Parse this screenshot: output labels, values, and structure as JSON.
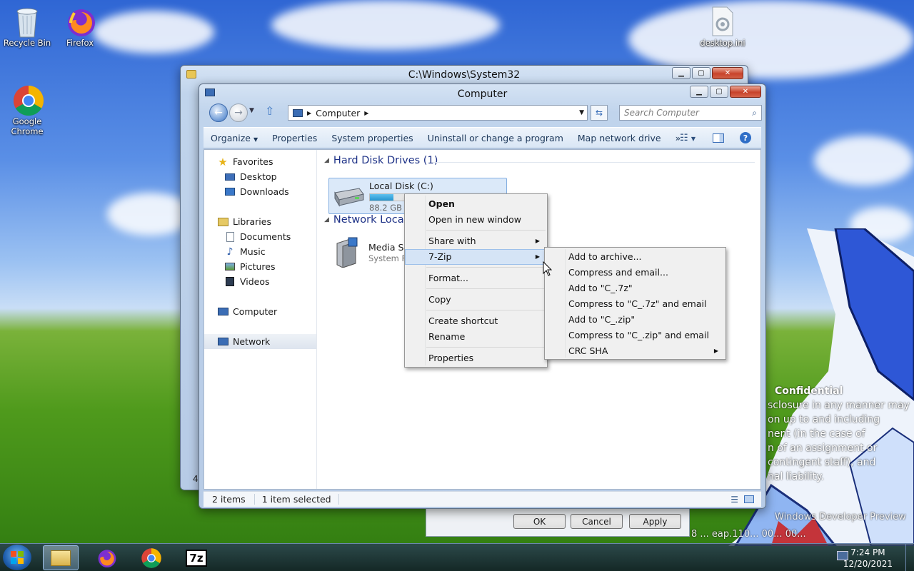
{
  "desktop": {
    "icons": [
      {
        "label": "Recycle Bin"
      },
      {
        "label": "Firefox"
      },
      {
        "label": "Google Chrome"
      },
      {
        "label": "desktop.ini"
      }
    ],
    "confidential": {
      "title": "Confidential",
      "lines": [
        "sclosure in any manner may",
        "on up to and including",
        "nent (in the case of",
        "n of an assignment or",
        "contingent staff), and",
        "nal liability."
      ]
    },
    "watermark": {
      "line1": "Windows Developer Preview",
      "line2": "8 ... eap.110... 00... 00..."
    }
  },
  "bg_window": {
    "title": "C:\\Windows\\System32",
    "dialog_buttons": {
      "ok": "OK",
      "cancel": "Cancel",
      "apply": "Apply"
    },
    "side_digit": "4"
  },
  "explorer": {
    "title": "Computer",
    "address": {
      "path": "Computer"
    },
    "search": {
      "placeholder": "Search Computer"
    },
    "toolbar": {
      "organize": "Organize",
      "properties": "Properties",
      "system_properties": "System properties",
      "uninstall": "Uninstall or change a program",
      "map_drive": "Map network drive",
      "more": "»"
    },
    "nav": {
      "favorites": "Favorites",
      "desktop": "Desktop",
      "downloads": "Downloads",
      "libraries": "Libraries",
      "documents": "Documents",
      "music": "Music",
      "pictures": "Pictures",
      "videos": "Videos",
      "computer": "Computer",
      "network": "Network"
    },
    "groups": {
      "hard_disks": "Hard Disk Drives (1)",
      "network_locations": "Network Locati"
    },
    "drive": {
      "name": "Local Disk (C:)",
      "free": "88.2 GB fr",
      "used_fraction": 0.18
    },
    "media": {
      "name": "Media Ser",
      "sub": "System Fo"
    },
    "status": {
      "items": "2 items",
      "selected": "1 item selected"
    }
  },
  "context_menu": {
    "open": "Open",
    "open_new_window": "Open in new window",
    "share_with": "Share with",
    "seven_zip": "7-Zip",
    "format": "Format...",
    "copy": "Copy",
    "create_shortcut": "Create shortcut",
    "rename": "Rename",
    "properties": "Properties"
  },
  "submenu": {
    "add_archive": "Add to archive...",
    "compress_email": "Compress and email...",
    "add_7z": "Add to \"C_.7z\"",
    "compress_7z_email": "Compress to \"C_.7z\" and email",
    "add_zip": "Add to \"C_.zip\"",
    "compress_zip_email": "Compress to \"C_.zip\" and email",
    "crc_sha": "CRC SHA"
  },
  "taskbar": {
    "time": "7:24 PM",
    "date": "12/20/2021",
    "seven_zip_label": "7z"
  },
  "colors": {
    "accent": "#1e3287",
    "menu_highlight": "#d5e4f6",
    "drive_bar": "#26a0da"
  }
}
